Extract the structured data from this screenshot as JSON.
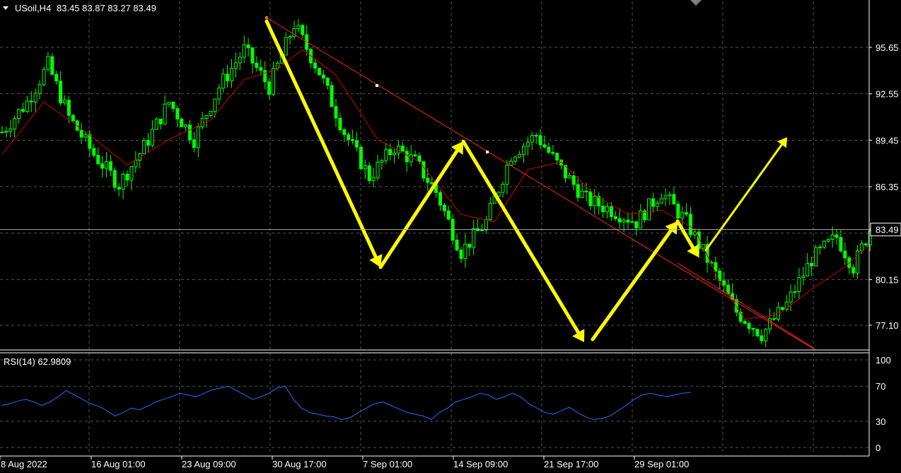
{
  "header": {
    "symbol": "USoil,H4",
    "ohlc": "83.45 83.87 83.27 83.49"
  },
  "rsi_label": "RSI(14) 62.9809",
  "current_price_label": "83.49",
  "colors": {
    "bull": "#00ff00",
    "grid": "#555555",
    "ma": "#cc0000",
    "trend": "#ff2020",
    "arrow": "#ffff00",
    "rsi": "#1e6fff",
    "frame": "#ffffff"
  },
  "chart_data": [
    {
      "type": "candlestick",
      "ylim": [
        75.5,
        98.5
      ],
      "yticks": [
        77.1,
        80.15,
        83.25,
        86.35,
        89.45,
        92.55,
        95.65
      ],
      "ytick_labels": [
        "77.10",
        "80.15",
        "",
        "86.35",
        "89.45",
        "92.55",
        "95.65"
      ],
      "xtick_labels": [
        "8 Aug 2022",
        "16 Aug 01:00",
        "23 Aug 09:00",
        "30 Aug 17:00",
        "7 Sep 01:00",
        "14 Sep 09:00",
        "21 Sep 17:00",
        "29 Sep 01:00"
      ],
      "close_path": [
        [
          0,
          90.0
        ],
        [
          6,
          92.0
        ],
        [
          11,
          94.5
        ],
        [
          16,
          91.0
        ],
        [
          22,
          88.5
        ],
        [
          28,
          86.5
        ],
        [
          34,
          89.0
        ],
        [
          40,
          92.0
        ],
        [
          46,
          89.5
        ],
        [
          52,
          93.0
        ],
        [
          58,
          95.5
        ],
        [
          64,
          93.0
        ],
        [
          70,
          97.2
        ],
        [
          76,
          94.0
        ],
        [
          82,
          90.0
        ],
        [
          88,
          87.0
        ],
        [
          94,
          89.0
        ],
        [
          99,
          88.0
        ],
        [
          104,
          86.0
        ],
        [
          110,
          82.0
        ],
        [
          116,
          84.0
        ],
        [
          122,
          88.5
        ],
        [
          128,
          89.8
        ],
        [
          134,
          87.5
        ],
        [
          140,
          85.5
        ],
        [
          146,
          84.8
        ],
        [
          152,
          84.0
        ],
        [
          158,
          86.0
        ],
        [
          164,
          84.0
        ],
        [
          170,
          81.0
        ],
        [
          176,
          78.0
        ],
        [
          182,
          76.5
        ],
        [
          188,
          78.5
        ],
        [
          194,
          81.5
        ],
        [
          200,
          83.0
        ],
        [
          204,
          81.0
        ],
        [
          208,
          83.49
        ]
      ],
      "ma_path": [
        [
          0,
          88.5
        ],
        [
          10,
          92.0
        ],
        [
          20,
          90.0
        ],
        [
          30,
          87.8
        ],
        [
          40,
          89.5
        ],
        [
          50,
          90.8
        ],
        [
          58,
          93.5
        ],
        [
          66,
          94.2
        ],
        [
          72,
          95.5
        ],
        [
          80,
          93.8
        ],
        [
          90,
          89.5
        ],
        [
          100,
          88.0
        ],
        [
          110,
          84.5
        ],
        [
          118,
          84.0
        ],
        [
          126,
          87.5
        ],
        [
          134,
          88.0
        ],
        [
          142,
          85.8
        ],
        [
          150,
          84.5
        ],
        [
          158,
          84.8
        ],
        [
          166,
          83.5
        ],
        [
          172,
          80.0
        ],
        [
          178,
          77.5
        ],
        [
          186,
          77.8
        ],
        [
          194,
          79.5
        ],
        [
          202,
          81.0
        ],
        [
          208,
          82.5
        ]
      ],
      "trendline": [
        [
          377,
          25
        ],
        [
          1153,
          495
        ]
      ],
      "trend_markers": [
        [
          533,
          121
        ],
        [
          689,
          215
        ]
      ],
      "arrows": [
        [
          [
            377,
            30
          ],
          [
            538,
            378
          ]
        ],
        [
          [
            538,
            378
          ],
          [
            655,
            200
          ]
        ],
        [
          [
            655,
            200
          ],
          [
            826,
            484
          ]
        ],
        [
          [
            838,
            480
          ],
          [
            958,
            313
          ]
        ],
        [
          [
            958,
            313
          ],
          [
            988,
            364
          ]
        ],
        [
          [
            998,
            354
          ],
          [
            1113,
            194
          ]
        ]
      ]
    },
    {
      "type": "line",
      "name": "RSI(14) 62.9809",
      "ylim": [
        0,
        100
      ],
      "yticks": [
        0,
        30,
        70,
        100
      ],
      "ytick_labels": [
        "0",
        "30",
        "70",
        "100"
      ],
      "values": [
        48,
        50,
        53,
        55,
        52,
        48,
        52,
        58,
        65,
        60,
        55,
        50,
        47,
        42,
        36,
        40,
        45,
        43,
        47,
        52,
        55,
        58,
        62,
        60,
        58,
        62,
        66,
        68,
        70,
        65,
        60,
        55,
        58,
        62,
        68,
        70,
        55,
        45,
        40,
        38,
        36,
        35,
        32,
        34,
        40,
        45,
        50,
        52,
        48,
        44,
        40,
        38,
        36,
        32,
        40,
        45,
        52,
        55,
        58,
        62,
        60,
        55,
        58,
        62,
        58,
        50,
        45,
        40,
        38,
        42,
        46,
        40,
        35,
        32,
        33,
        36,
        42,
        48,
        55,
        60,
        62,
        60,
        58,
        60,
        62,
        63
      ]
    }
  ]
}
